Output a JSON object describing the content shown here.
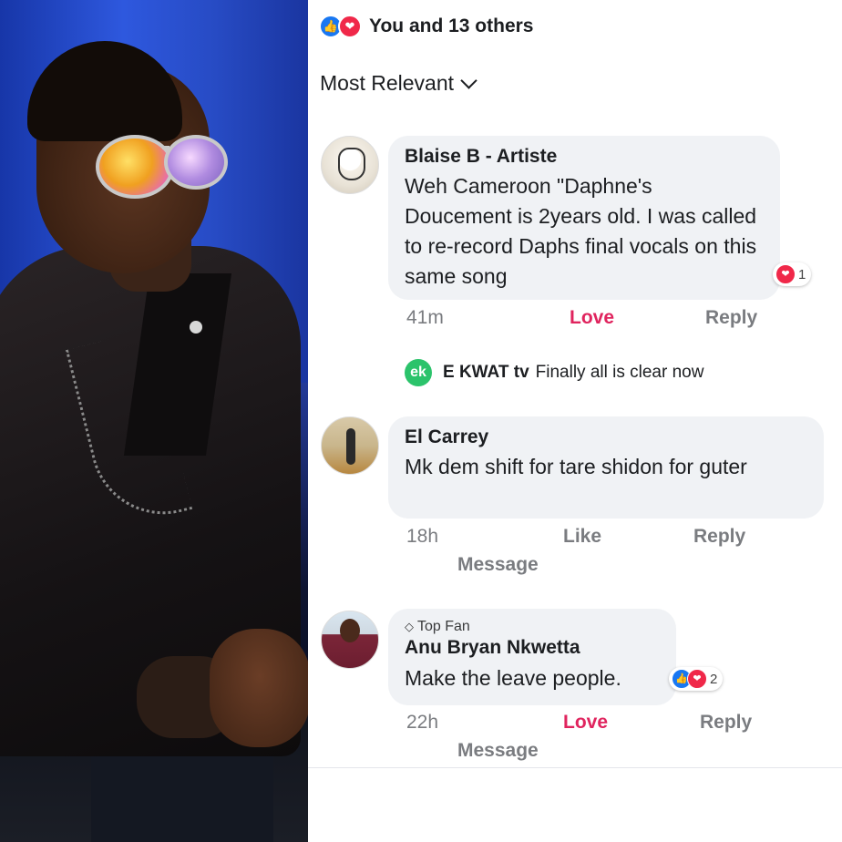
{
  "reactions": {
    "summary": "You and 13 others",
    "icons": [
      "like-icon",
      "love-icon"
    ],
    "like_color": "#1877f2",
    "love_color": "#f02849"
  },
  "sort": {
    "label": "Most Relevant"
  },
  "comments": [
    {
      "author": "Blaise B - Artiste",
      "text": "Weh Cameroon \"Daphne's Doucement is 2years old. I was called to re-record Daphs final vocals on this same song",
      "reaction_count": "1",
      "time": "41m",
      "action_react": "Love",
      "action_reply": "Reply",
      "reply": {
        "author": "E KWAT tv",
        "text": "Finally all is clear now",
        "logo_text": "ek"
      }
    },
    {
      "author": "El Carrey",
      "text": "Mk dem shift for tare shidon for guter",
      "time": "18h",
      "action_react": "Like",
      "action_reply": "Reply",
      "action_message": "Message"
    },
    {
      "badge": "Top Fan",
      "author": "Anu Bryan Nkwetta",
      "text": "Make the leave people.",
      "reaction_count": "2",
      "time": "22h",
      "action_react": "Love",
      "action_reply": "Reply",
      "action_message": "Message"
    }
  ],
  "colors": {
    "love_text": "#e0245e",
    "meta_grey": "#7a7c80",
    "bubble_bg": "#f0f2f5",
    "ekwat_green": "#2bc36b"
  }
}
